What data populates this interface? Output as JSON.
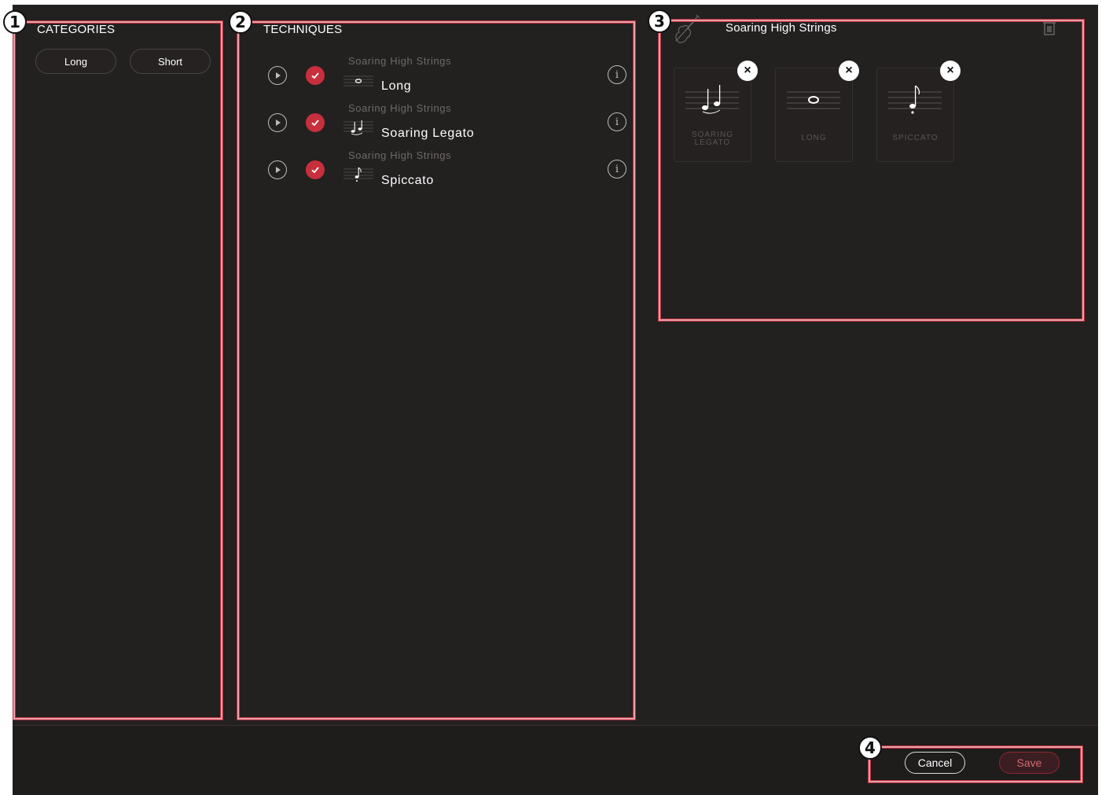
{
  "categories": {
    "title": "CATEGORIES",
    "filters": [
      {
        "label": "Long"
      },
      {
        "label": "Short"
      }
    ]
  },
  "techniques": {
    "title": "TECHNIQUES",
    "rows": [
      {
        "instrument": "Soaring High Strings",
        "name": "Long",
        "icon": "whole-note-icon"
      },
      {
        "instrument": "Soaring High Strings",
        "name": "Soaring Legato",
        "icon": "legato-notes-icon"
      },
      {
        "instrument": "Soaring High Strings",
        "name": "Spiccato",
        "icon": "staccato-note-icon"
      }
    ]
  },
  "selection": {
    "title": "Soaring High Strings",
    "cards": [
      {
        "label": "SOARING\nLEGATO"
      },
      {
        "label": "LONG"
      },
      {
        "label": "SPICCATO"
      }
    ]
  },
  "footer": {
    "cancel_label": "Cancel",
    "save_label": "Save"
  },
  "annotations": [
    "1",
    "2",
    "3",
    "4"
  ],
  "colors": {
    "background": "#232020",
    "accent": "#c72f3c",
    "highlight_frame": "#e8a0a6"
  }
}
